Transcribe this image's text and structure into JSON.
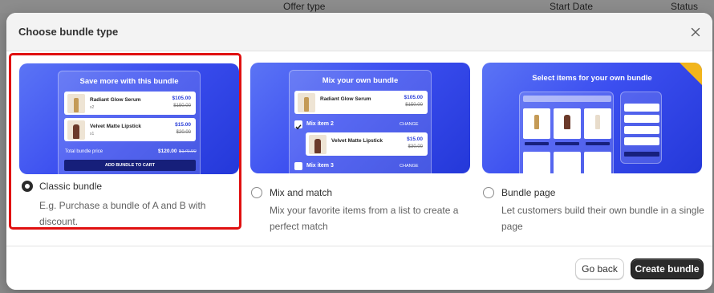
{
  "background": {
    "columns": [
      "Offer type",
      "Start Date",
      "Status"
    ]
  },
  "modal": {
    "title": "Choose bundle type",
    "close_icon": "close-icon"
  },
  "options": [
    {
      "label": "Classic bundle",
      "description": "E.g. Purchase a bundle of A and B with discount.",
      "selected": true,
      "preview": {
        "title": "Save more with this bundle",
        "items": [
          {
            "name": "Radiant Glow Serum",
            "qty": "x2",
            "price": "$105.00",
            "old_price": "$150.00"
          },
          {
            "name": "Velvet Matte Lipstick",
            "qty": "x1",
            "price": "$15.00",
            "old_price": "$20.00"
          }
        ],
        "total_label": "Total bundle price",
        "total_price": "$120.00",
        "total_old": "$170.00",
        "cta": "ADD BUNDLE TO CART"
      }
    },
    {
      "label": "Mix and match",
      "description": "Mix your favorite items from a list to create a perfect match",
      "selected": false,
      "preview": {
        "title": "Mix your own bundle",
        "top_item": {
          "name": "Radiant Glow Serum",
          "price": "$105.00",
          "old_price": "$150.00"
        },
        "mix_item_2": "Mix item 2",
        "mix_item_2_item": {
          "name": "Velvet Matte Lipstick",
          "price": "$15.00",
          "old_price": "$30.00"
        },
        "mix_item_3": "Mix item 3",
        "change": "CHANGE"
      }
    },
    {
      "label": "Bundle page",
      "description": "Let customers build their own bundle in a single page",
      "selected": false,
      "preview": {
        "title": "Select items for your own bundle"
      }
    }
  ],
  "footer": {
    "back_label": "Go back",
    "create_label": "Create bundle"
  },
  "colors": {
    "accent_dark": "#2b2b2b",
    "selection_border": "#e01010",
    "preview_blue": "#3c4ff0"
  }
}
